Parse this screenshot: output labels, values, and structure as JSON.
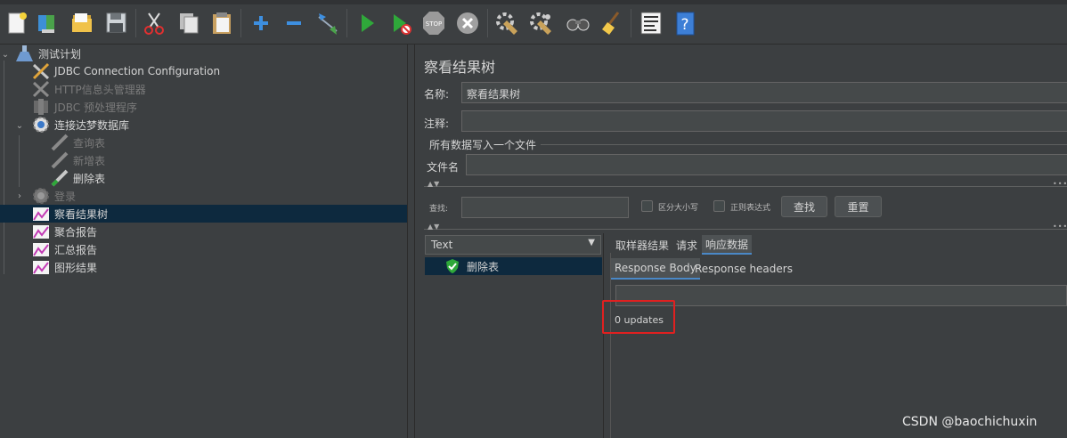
{
  "toolbar": {
    "icons": [
      "new-icon",
      "templates-icon",
      "open-icon",
      "save-icon",
      "cut-icon",
      "copy-icon",
      "paste-icon",
      "expand-icon",
      "collapse-icon",
      "toggle-icon",
      "start-icon",
      "start-no-pause-icon",
      "stop-icon",
      "shutdown-icon",
      "clear-icon",
      "clear-all-icon",
      "search-icon",
      "reset-search-icon",
      "function-helper-icon",
      "help-icon"
    ]
  },
  "tree": {
    "nodes": [
      {
        "label": "测试计划"
      },
      {
        "label": "JDBC Connection Configuration"
      },
      {
        "label": "HTTP信息头管理器"
      },
      {
        "label": "JDBC 预处理程序"
      },
      {
        "label": "连接达梦数据库"
      },
      {
        "label": "查询表"
      },
      {
        "label": "新增表"
      },
      {
        "label": "删除表"
      },
      {
        "label": "登录"
      },
      {
        "label": "察看结果树"
      },
      {
        "label": "聚合报告"
      },
      {
        "label": "汇总报告"
      },
      {
        "label": "图形结果"
      }
    ]
  },
  "panel": {
    "title": "察看结果树",
    "name_label": "名称:",
    "name_value": "察看结果树",
    "comment_label": "注释:",
    "comment_value": "",
    "file_group_title": "所有数据写入一个文件",
    "filename_label": "文件名",
    "filename_value": "",
    "search_label": "查找:",
    "case_label": "区分大小写",
    "regex_label": "正则表达式",
    "find_button": "查找",
    "reset_button": "重置",
    "renderer_value": "Text",
    "result_item": "删除表",
    "tabs": [
      "取样器结果",
      "请求",
      "响应数据"
    ],
    "subtabs": [
      "Response Body",
      "Response headers"
    ],
    "response_text": "0 updates",
    "collapse_glyph": "▲▼",
    "more_glyph": "•••"
  },
  "watermark": "CSDN @baochichuxin"
}
